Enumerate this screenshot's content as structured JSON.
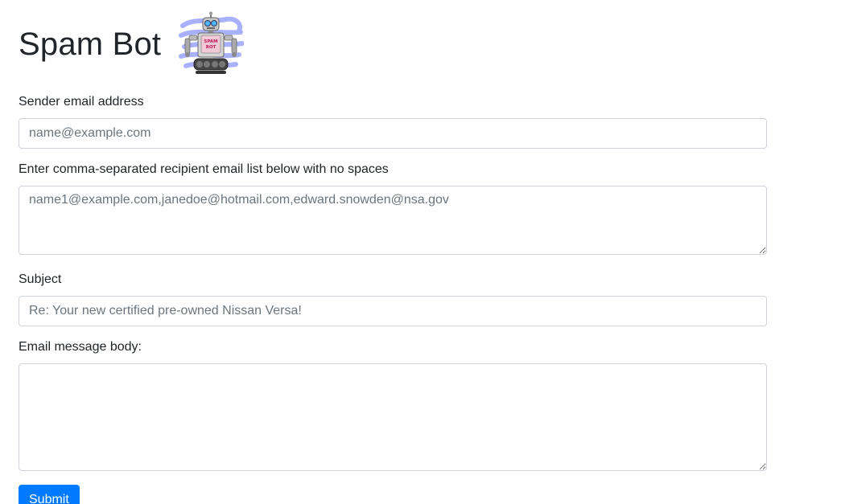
{
  "header": {
    "title": "Spam Bot",
    "logo_icon": "robot-icon",
    "logo_text": "SPAM BOT"
  },
  "form": {
    "sender": {
      "label": "Sender email address",
      "placeholder": "name@example.com",
      "value": ""
    },
    "recipients": {
      "label": "Enter comma-separated recipient email list below with no spaces",
      "placeholder": "name1@example.com,janedoe@hotmail.com,edward.snowden@nsa.gov",
      "value": ""
    },
    "subject": {
      "label": "Subject",
      "placeholder": "Re: Your new certified pre-owned Nissan Versa!",
      "value": ""
    },
    "body": {
      "label": "Email message body:",
      "placeholder": "",
      "value": ""
    },
    "submit_label": "Submit"
  },
  "colors": {
    "primary": "#007bff",
    "border": "#ced4da",
    "text": "#212529",
    "placeholder": "#6c757d"
  }
}
